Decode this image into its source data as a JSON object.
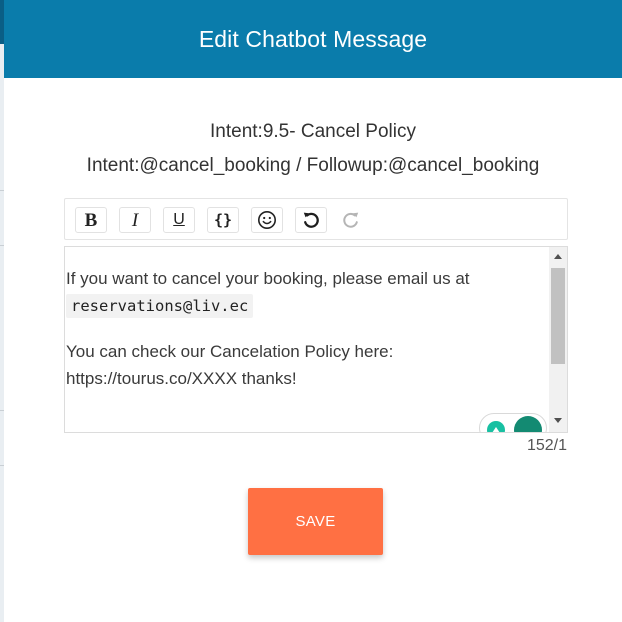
{
  "modal": {
    "title": "Edit Chatbot Message",
    "intent_line": "Intent:9.5- Cancel Policy",
    "followup_line": "Intent:@cancel_booking / Followup:@cancel_booking"
  },
  "toolbar": {
    "bold_label": "B",
    "italic_label": "I",
    "underline_label": "U",
    "code_label": "{}",
    "icons": [
      "bold-icon",
      "italic-icon",
      "underline-icon",
      "code-braces-icon",
      "emoji-icon",
      "undo-icon",
      "redo-icon"
    ]
  },
  "editor": {
    "para1_text": "If you want to cancel your booking, please email us at",
    "email": "reservations@liv.ec",
    "para2_line1": "You can check our Cancelation Policy here:",
    "para2_line2": "https://tourus.co/XXXX thanks!",
    "char_count": "152/1"
  },
  "actions": {
    "save_label": "SAVE"
  },
  "colors": {
    "header": "#0a7cab",
    "save": "#ff7043",
    "grammar_green": "#18c0a2",
    "grammar_dark": "#138a72"
  }
}
